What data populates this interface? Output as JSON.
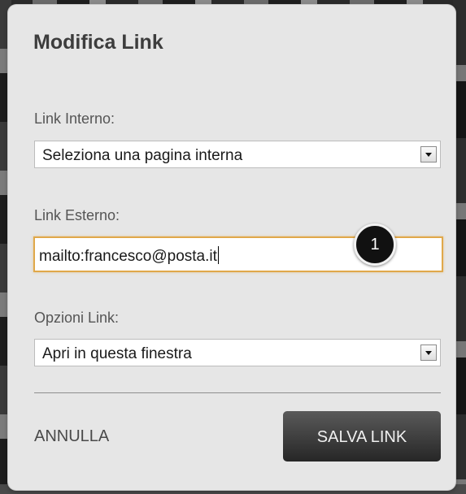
{
  "dialog": {
    "title": "Modifica Link",
    "internal_link": {
      "label": "Link Interno:",
      "selected": "Seleziona una pagina interna"
    },
    "external_link": {
      "label": "Link Esterno:",
      "value": "mailto:francesco@posta.it"
    },
    "link_options": {
      "label": "Opzioni Link:",
      "selected": "Apri in questa finestra"
    },
    "cancel_label": "ANNULLA",
    "save_label": "SALVA LINK"
  },
  "annotation": {
    "number": "1"
  },
  "colors": {
    "dialog_bg": "#e6e6e6",
    "focus_border": "#e0a84a",
    "save_button": "#262626"
  },
  "icons": [
    "chevron-down-icon"
  ]
}
